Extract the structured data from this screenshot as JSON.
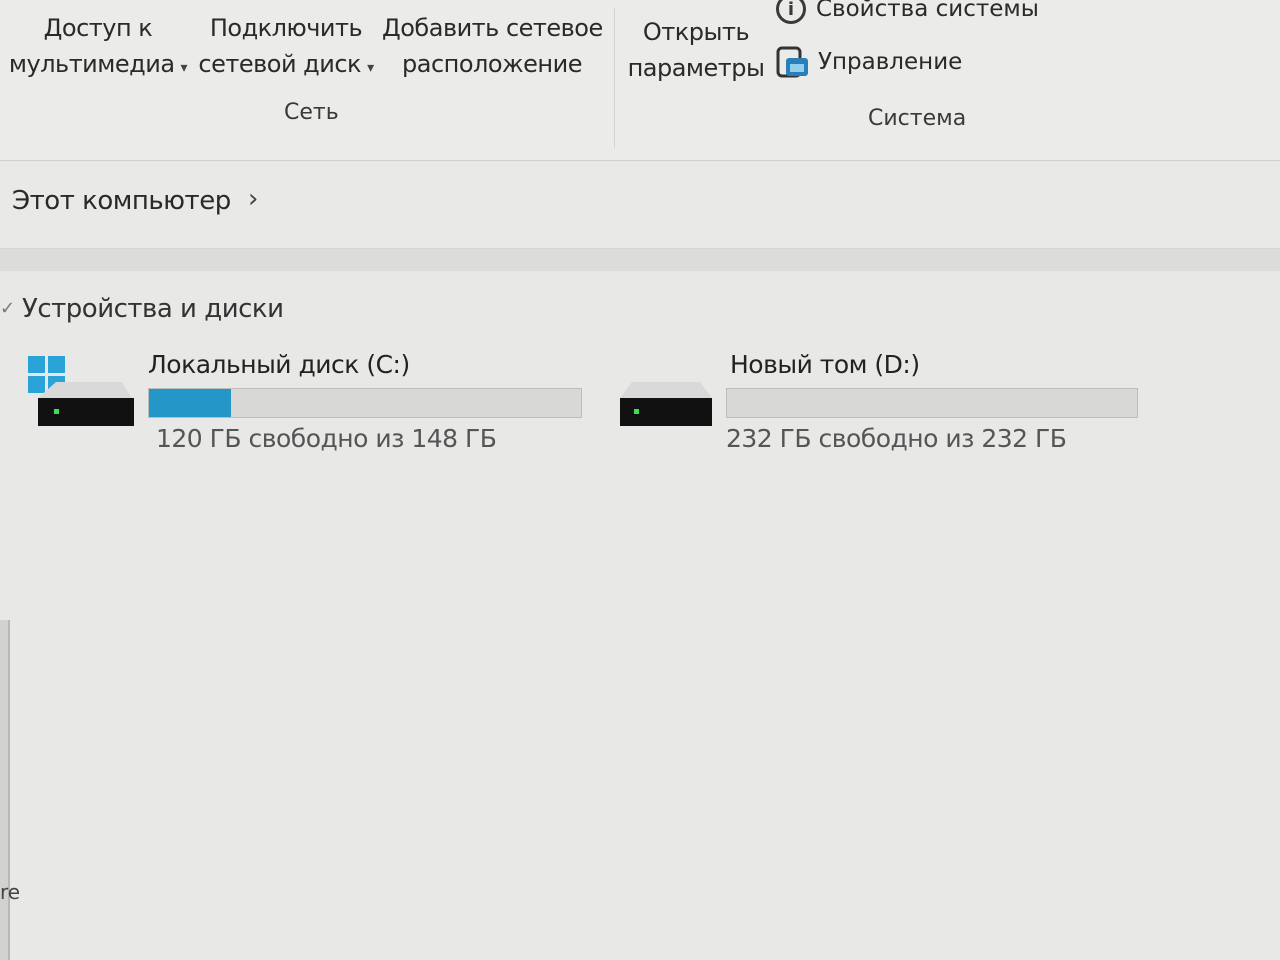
{
  "ribbon": {
    "network": {
      "media_access": {
        "line1": "Доступ к",
        "line2": "мультимедиа"
      },
      "map_drive": {
        "line1": "Подключить",
        "line2": "сетевой диск"
      },
      "add_location": {
        "line1": "Добавить сетевое",
        "line2": "расположение"
      },
      "group_label": "Сеть"
    },
    "system": {
      "open_settings": {
        "line1": "Открыть",
        "line2": "параметры"
      },
      "properties": "Свойства системы",
      "manage": "Управление",
      "group_label": "Система"
    }
  },
  "address": {
    "crumb": "Этот компьютер",
    "separator": "›"
  },
  "section": {
    "title": "Устройства и диски"
  },
  "drives": [
    {
      "name": "Локальный диск (C:)",
      "free_text": "120 ГБ свободно из 148 ГБ",
      "used_fraction": 0.19
    },
    {
      "name": "Новый том (D:)",
      "free_text": "232 ГБ свободно из 232 ГБ",
      "used_fraction": 0.0
    }
  ],
  "edge_text": "re",
  "colors": {
    "accent": "#2596c8",
    "drive_body": "#111111"
  }
}
